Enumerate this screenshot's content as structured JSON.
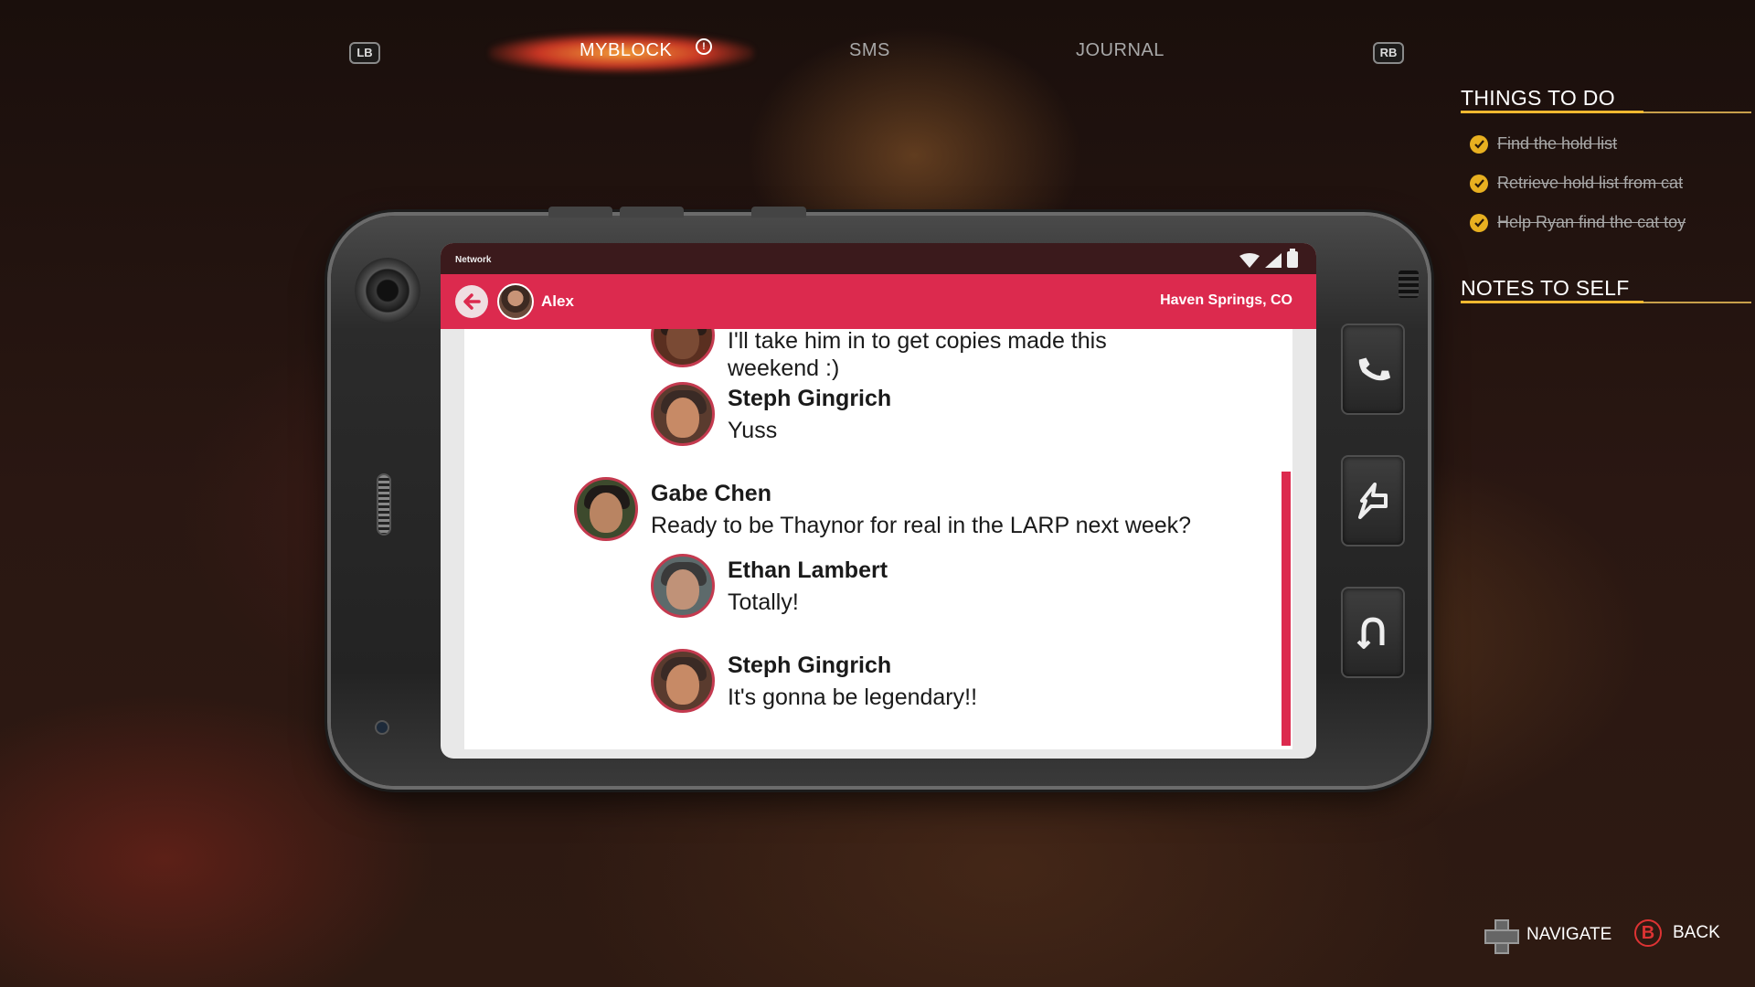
{
  "nav": {
    "left_bumper": "LB",
    "right_bumper": "RB",
    "tabs": [
      {
        "label": "MYBLOCK",
        "active": true,
        "alert": "!"
      },
      {
        "label": "SMS",
        "active": false
      },
      {
        "label": "JOURNAL",
        "active": false
      }
    ]
  },
  "phone": {
    "status": {
      "network": "Network"
    },
    "header": {
      "contact": "Alex",
      "location": "Haven Springs, CO"
    },
    "messages": [
      {
        "sender": "",
        "lines": [
          "I'll take him in to get copies made this",
          "weekend :)"
        ],
        "avatar": "partial-avatar"
      },
      {
        "sender": "Steph Gingrich",
        "lines": [
          "Yuss"
        ]
      },
      {
        "sender": "Gabe Chen",
        "lines": [
          "Ready to be Thaynor for real in the LARP next week?"
        ]
      },
      {
        "sender": "Ethan Lambert",
        "lines": [
          "Totally!"
        ]
      },
      {
        "sender": "Steph Gingrich",
        "lines": [
          "It's gonna be legendary!!"
        ]
      }
    ],
    "side_actions": [
      "phone-icon",
      "power-icon",
      "magnet-icon"
    ]
  },
  "panel": {
    "things_to_do_title": "THINGS TO DO",
    "todos": [
      {
        "label": "Find the hold list",
        "done": true
      },
      {
        "label": "Retrieve hold list from cat",
        "done": true
      },
      {
        "label": "Help Ryan find the cat toy",
        "done": true
      }
    ],
    "notes_title": "NOTES TO SELF"
  },
  "hints": {
    "navigate": "NAVIGATE",
    "back": "BACK",
    "back_button": "B"
  },
  "colors": {
    "accent": "#dc2a4e",
    "gold": "#f0b830"
  }
}
